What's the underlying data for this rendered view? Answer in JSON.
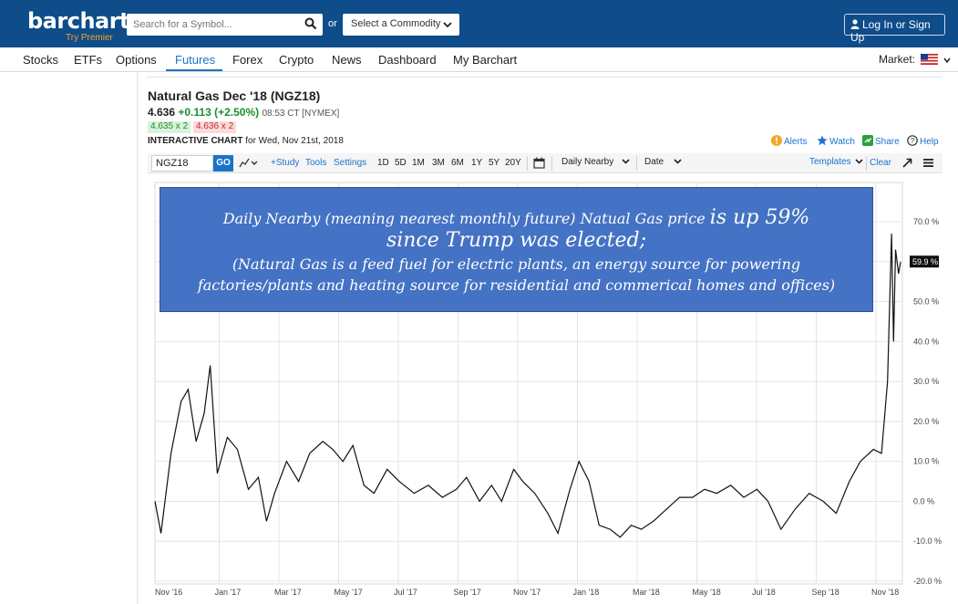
{
  "header": {
    "logo_text": "barchart",
    "logo_sub": "Try Premier",
    "search_placeholder": "Search for a Symbol...",
    "or_text": "or",
    "commodity_label": "Select a Commodity",
    "login_label": "Log In or Sign Up"
  },
  "nav": {
    "items": [
      "Stocks",
      "ETFs",
      "Options",
      "Futures",
      "Forex",
      "Crypto",
      "News",
      "Dashboard",
      "My Barchart"
    ],
    "active": "Futures",
    "market_label": "Market:"
  },
  "quote": {
    "title": "Natural Gas Dec '18 (NGZ18)",
    "last": "4.636",
    "change": "+0.113 (+2.50%)",
    "time": "08:53 CT [NYMEX]",
    "bid": "4.635 x 2",
    "ask": "4.636 x 2",
    "chart_label": "INTERACTIVE CHART",
    "chart_date": "for Wed, Nov 21st, 2018"
  },
  "actions": {
    "alerts": "Alerts",
    "watch": "Watch",
    "share": "Share",
    "help": "Help"
  },
  "toolbar": {
    "symbol": "NGZ18",
    "go": "GO",
    "study": "+Study",
    "tools": "Tools",
    "settings": "Settings",
    "periods": [
      "1D",
      "5D",
      "1M",
      "3M",
      "6M",
      "1Y",
      "5Y",
      "20Y"
    ],
    "nearby": "Daily Nearby",
    "date": "Date",
    "templates": "Templates",
    "clear": "Clear"
  },
  "annotation": {
    "line1a": "Daily Nearby (meaning nearest monthly future) Natual Gas price",
    "line1b": "is up 59%",
    "line2": "since Trump was elected;",
    "line3": "(Natural Gas is a feed fuel for electric plants, an energy source for powering",
    "line4": "factories/plants and heating source for residential and commerical homes and offices)"
  },
  "colors": {
    "header_bg": "#0f4c8a",
    "accent": "#1a73c8",
    "positive": "#1a8f2e",
    "annotation_bg": "#4472c4"
  },
  "chart_data": {
    "type": "line",
    "x_ticks": [
      "Nov '16",
      "Jan '17",
      "Mar '17",
      "May '17",
      "Jul '17",
      "Sep '17",
      "Nov '17",
      "Jan '18",
      "Mar '18",
      "May '18",
      "Jul '18",
      "Sep '18",
      "Nov '18"
    ],
    "y_ticks": [
      "70.0 %",
      "60.0 %",
      "50.0 %",
      "40.0 %",
      "30.0 %",
      "20.0 %",
      "10.0 %",
      "0.0 %",
      "-10.0 %",
      "-20.0 %"
    ],
    "ylim": [
      -20,
      70
    ],
    "last_label": "59.9 %",
    "series": [
      {
        "x": [
          "2016-11-09",
          "2016-11-15",
          "2016-11-25",
          "2016-12-05",
          "2016-12-12",
          "2016-12-20",
          "2016-12-28",
          "2017-01-03",
          "2017-01-10",
          "2017-01-20",
          "2017-01-30",
          "2017-02-10",
          "2017-02-20",
          "2017-02-28",
          "2017-03-08",
          "2017-03-20",
          "2017-04-01",
          "2017-04-12",
          "2017-04-25",
          "2017-05-05",
          "2017-05-15",
          "2017-05-25",
          "2017-06-05",
          "2017-06-15",
          "2017-06-28",
          "2017-07-10",
          "2017-07-25",
          "2017-08-08",
          "2017-08-22",
          "2017-09-05",
          "2017-09-15",
          "2017-09-28",
          "2017-10-10",
          "2017-10-20",
          "2017-11-01",
          "2017-11-10",
          "2017-11-22",
          "2017-12-05",
          "2017-12-15",
          "2017-12-27",
          "2018-01-05",
          "2018-01-15",
          "2018-01-25",
          "2018-02-05",
          "2018-02-15",
          "2018-02-26",
          "2018-03-08",
          "2018-03-20",
          "2018-04-02",
          "2018-04-15",
          "2018-04-28",
          "2018-05-10",
          "2018-05-22",
          "2018-06-05",
          "2018-06-18",
          "2018-07-01",
          "2018-07-12",
          "2018-07-25",
          "2018-08-08",
          "2018-08-22",
          "2018-09-05",
          "2018-09-18",
          "2018-10-01",
          "2018-10-12",
          "2018-10-25",
          "2018-11-02",
          "2018-11-08",
          "2018-11-12",
          "2018-11-14",
          "2018-11-16",
          "2018-11-19",
          "2018-11-21"
        ],
        "y": [
          0,
          -8,
          12,
          25,
          28,
          15,
          22,
          34,
          7,
          16,
          13,
          3,
          6,
          -5,
          2,
          10,
          5,
          12,
          15,
          13,
          10,
          14,
          4,
          2,
          8,
          5,
          2,
          4,
          1,
          3,
          6,
          0,
          4,
          0,
          8,
          5,
          2,
          -3,
          -8,
          3,
          10,
          5,
          -6,
          -7,
          -9,
          -6,
          -7,
          -5,
          -2,
          1,
          1,
          3,
          2,
          4,
          1,
          3,
          0,
          -7,
          -2,
          2,
          0,
          -3,
          5,
          10,
          13,
          12,
          30,
          67,
          40,
          63,
          57,
          59.9
        ]
      }
    ]
  }
}
